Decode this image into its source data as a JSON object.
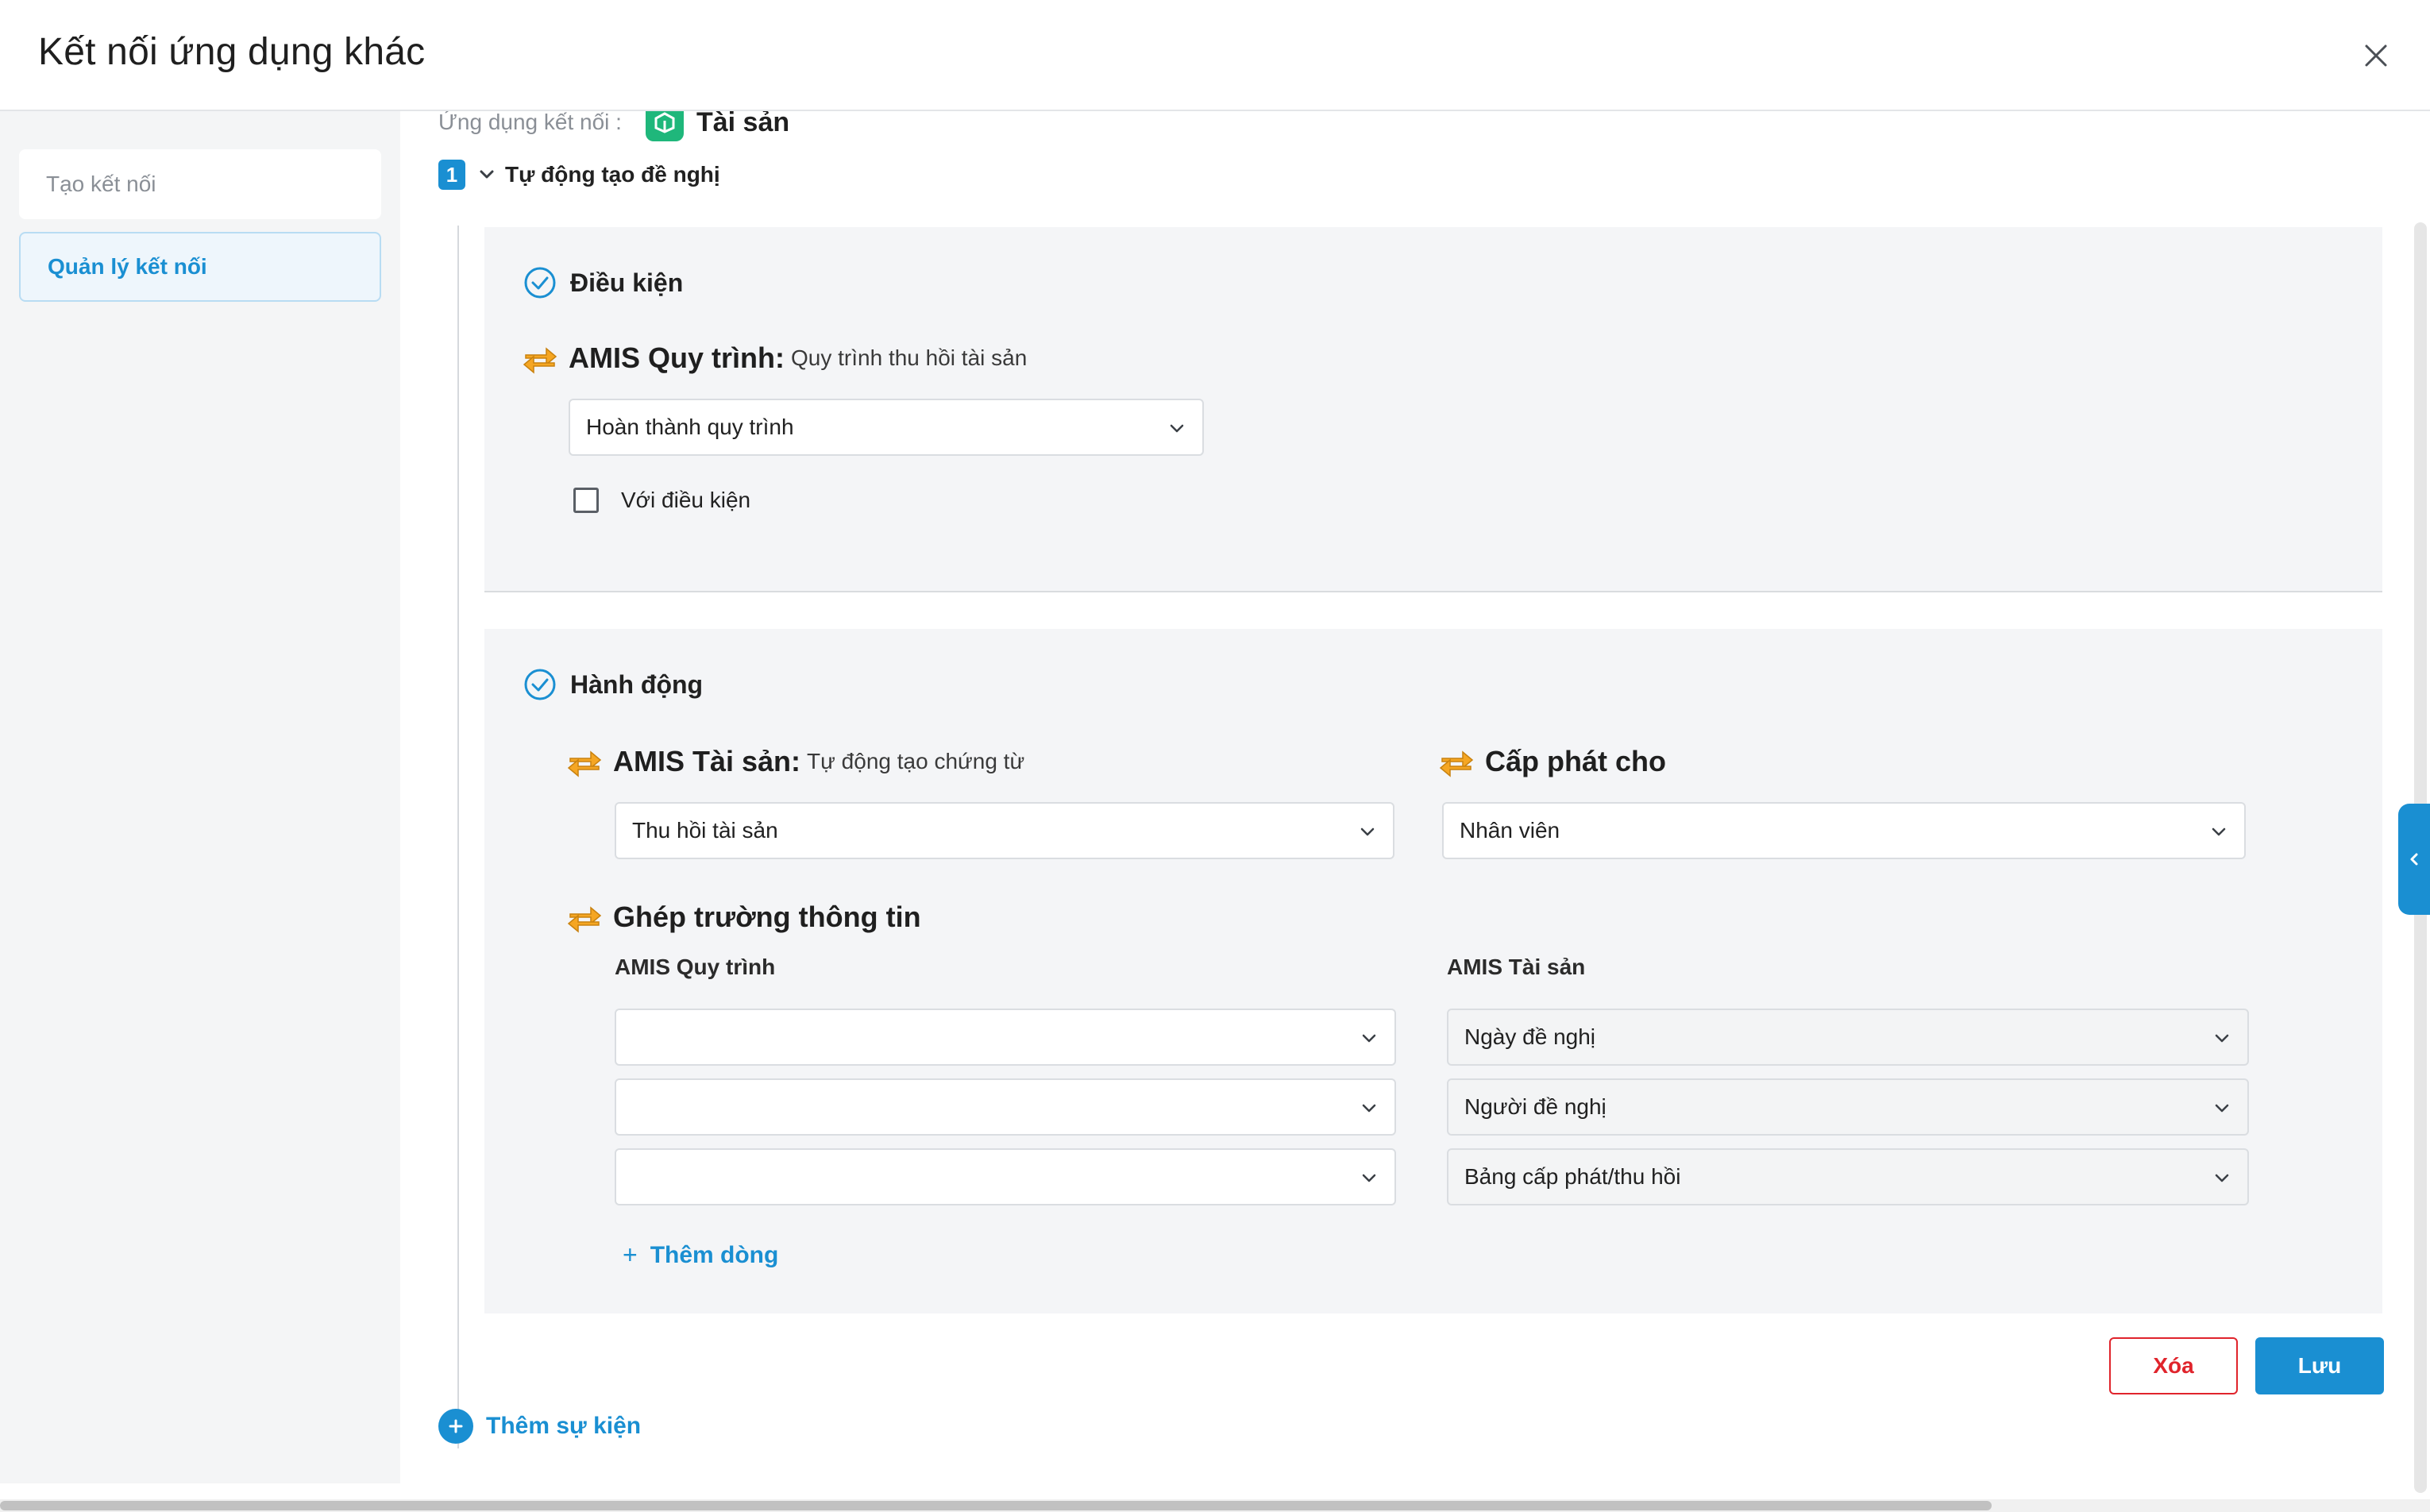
{
  "header": {
    "title": "Kết nối ứng dụng khác"
  },
  "sidebar": {
    "items": [
      {
        "label": "Tạo kết nối"
      },
      {
        "label": "Quản lý kết nối"
      }
    ]
  },
  "app_connect": {
    "label": "Ứng dụng kết nối :",
    "name": "Tài sản"
  },
  "event": {
    "index": "1",
    "title": "Tự động tạo đề nghị"
  },
  "condition": {
    "title": "Điều kiện",
    "source_app": "AMIS Quy trình:",
    "source_process": "Quy trình thu hồi tài sản",
    "trigger_value": "Hoàn thành quy trình",
    "with_condition_label": "Với điều kiện"
  },
  "action": {
    "title": "Hành động",
    "target_app": "AMIS Tài sản:",
    "target_desc": "Tự động tạo chứng từ",
    "document_type": "Thu hồi tài sản",
    "assign_label": "Cấp phát cho",
    "assign_value": "Nhân viên",
    "mapping_title": "Ghép trường thông tin",
    "col_left": "AMIS Quy trình",
    "col_right": "AMIS Tài sản",
    "mappings": [
      {
        "left": "",
        "right": "Ngày đề nghị"
      },
      {
        "left": "",
        "right": "Người đề nghị"
      },
      {
        "left": "",
        "right": "Bảng cấp phát/thu hồi"
      }
    ],
    "add_row_label": "Thêm dòng"
  },
  "buttons": {
    "delete": "Xóa",
    "save": "Lưu"
  },
  "add_event_label": "Thêm sự kiện",
  "colors": {
    "primary": "#1a8fd2",
    "danger": "#e0242c",
    "app_green": "#1fb77b",
    "icon_orange": "#f5a623"
  }
}
